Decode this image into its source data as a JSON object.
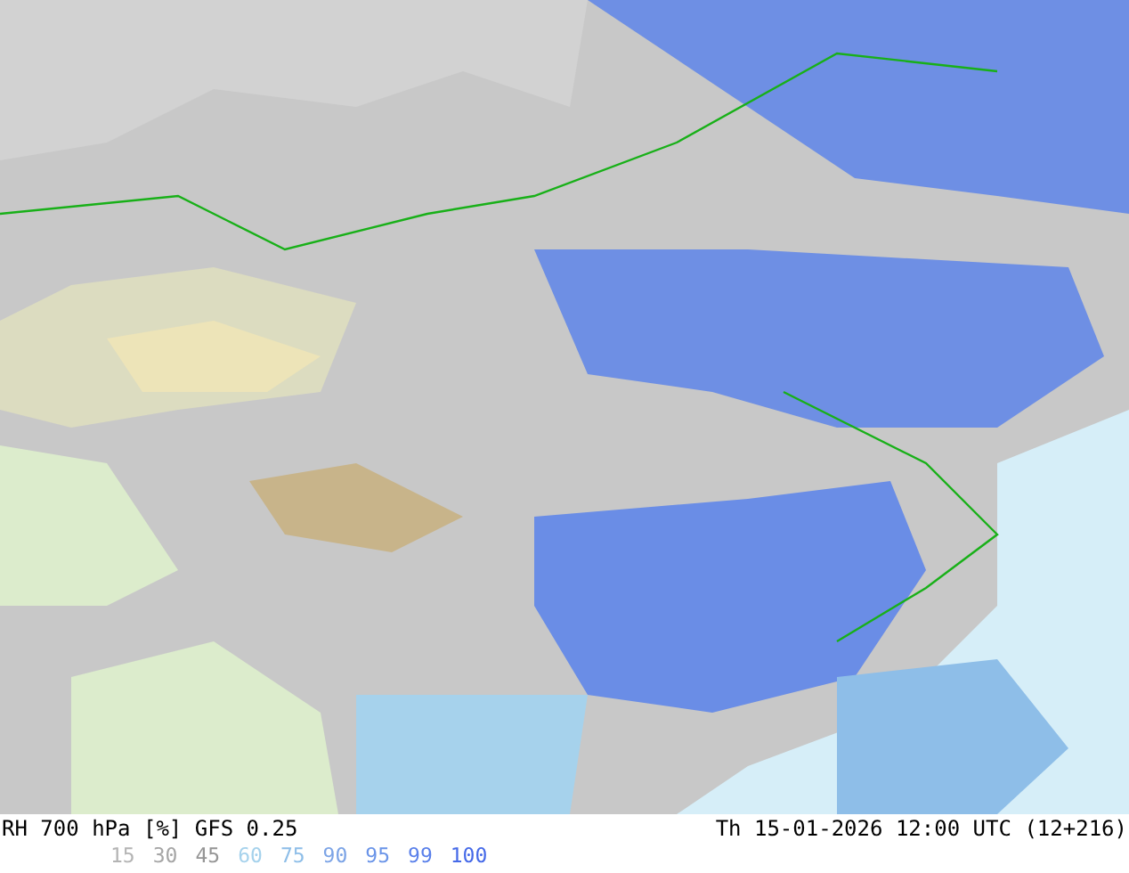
{
  "title": "RH 700 hPa [%] GFS 0.25",
  "valid_time": "Th 15-01-2026 12:00 UTC (12+216)",
  "legend": [
    {
      "label": "15",
      "color": "#b4b4b4"
    },
    {
      "label": "30",
      "color": "#a6a6a6"
    },
    {
      "label": "45",
      "color": "#959595"
    },
    {
      "label": "60",
      "color": "#a6d2ec"
    },
    {
      "label": "75",
      "color": "#8ebee8"
    },
    {
      "label": "90",
      "color": "#7ca4e6"
    },
    {
      "label": "95",
      "color": "#6a94e8"
    },
    {
      "label": "99",
      "color": "#5a80ea"
    },
    {
      "label": "100",
      "color": "#466ae8"
    }
  ]
}
